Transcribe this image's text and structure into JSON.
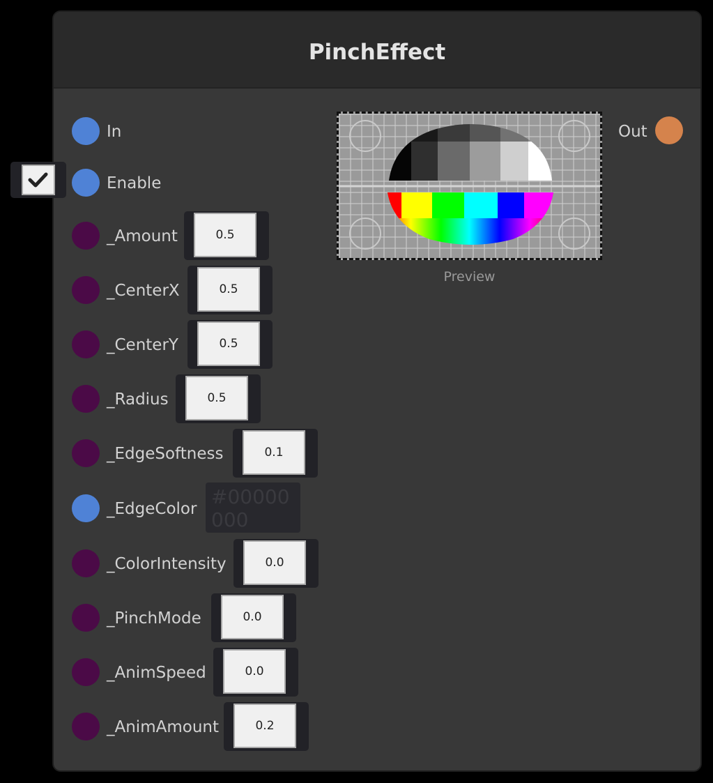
{
  "node": {
    "title": "PinchEffect"
  },
  "inputs": [
    {
      "label": "In",
      "type": "flow"
    },
    {
      "label": "Enable",
      "type": "flow",
      "checked": true
    },
    {
      "label": "_Amount",
      "value": "0.5"
    },
    {
      "label": "_CenterX",
      "value": "0.5"
    },
    {
      "label": "_CenterY",
      "value": "0.5"
    },
    {
      "label": "_Radius",
      "value": "0.5"
    },
    {
      "label": "_EdgeSoftness",
      "value": "0.1"
    },
    {
      "label": "_EdgeColor",
      "value": "#00000000"
    },
    {
      "label": "_ColorIntensity",
      "value": "0.0"
    },
    {
      "label": "_PinchMode",
      "value": "0.0"
    },
    {
      "label": "_AnimSpeed",
      "value": "0.0"
    },
    {
      "label": "_AnimAmount",
      "value": "0.2"
    }
  ],
  "output": {
    "label": "Out"
  },
  "preview": {
    "label": "Preview"
  },
  "colors": {
    "flow_port": "#4f82d6",
    "float_port": "#4b0a47",
    "output_port": "#d5834c",
    "node_body": "#383838",
    "node_header": "#2a2a2a"
  }
}
